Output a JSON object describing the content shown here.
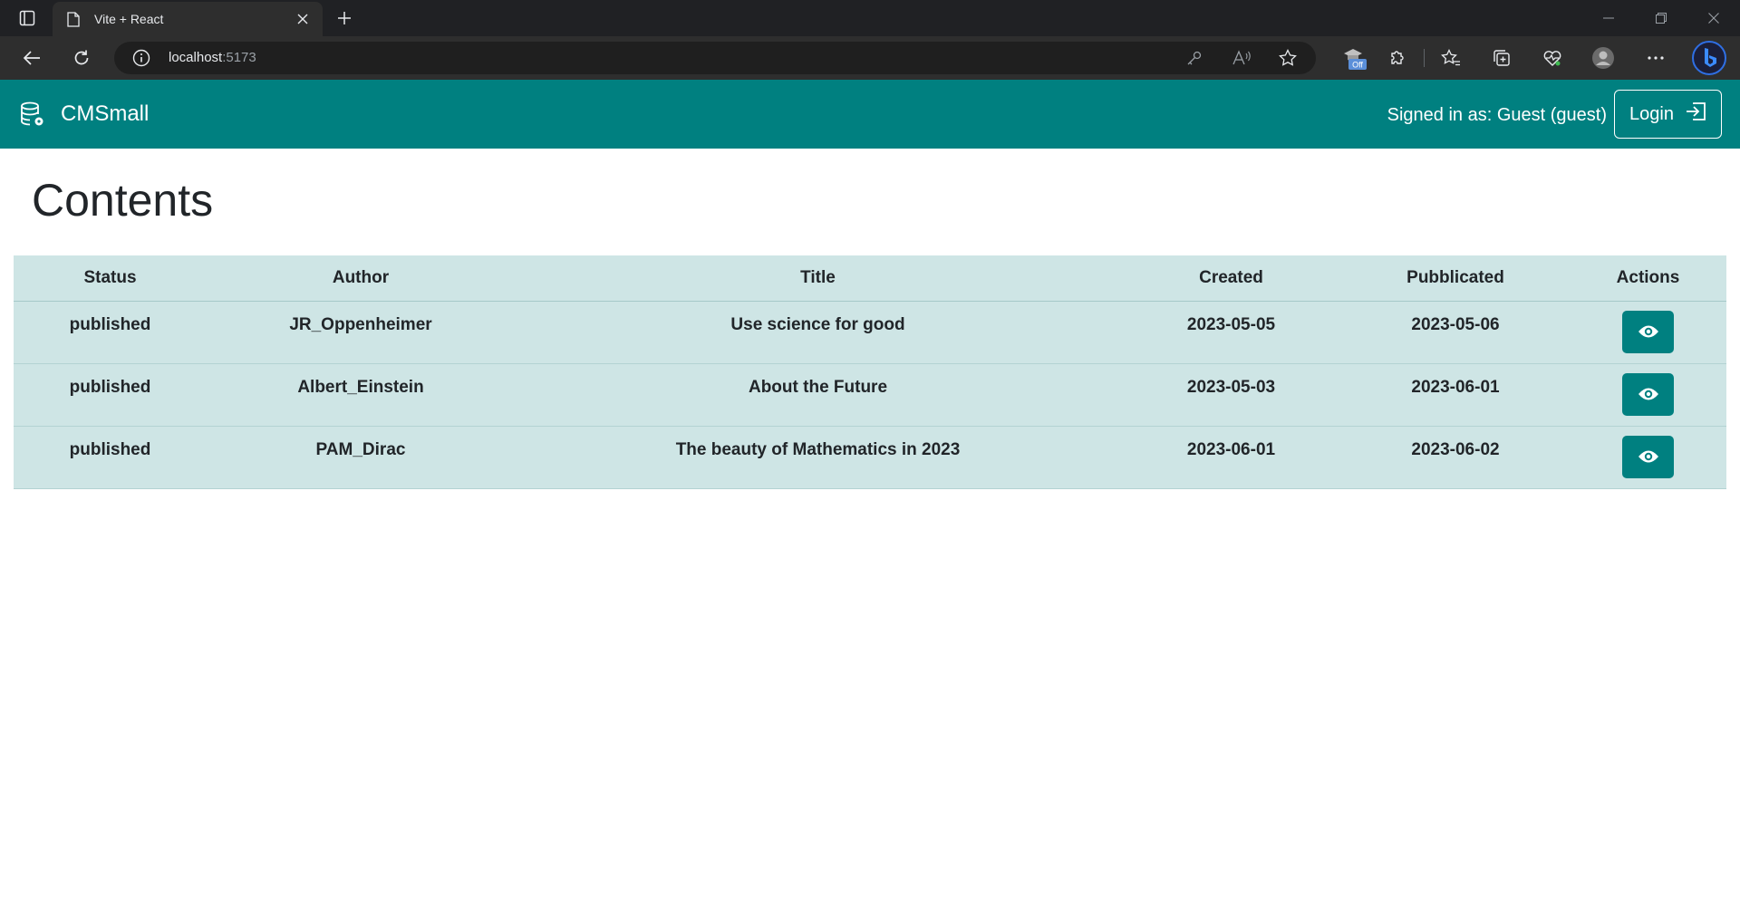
{
  "browser": {
    "tab_title": "Vite + React",
    "url_host": "localhost",
    "url_port": ":5173",
    "extension_badge": "Off"
  },
  "navbar": {
    "brand": "CMSmall",
    "signed_in_text": "Signed in as: Guest (guest)",
    "login_label": "Login",
    "bg_color": "#008080"
  },
  "page": {
    "title": "Contents"
  },
  "table": {
    "headers": [
      "Status",
      "Author",
      "Title",
      "Created",
      "Pubblicated",
      "Actions"
    ],
    "rows": [
      {
        "status": "published",
        "author": "JR_Oppenheimer",
        "title": "Use science for good",
        "created": "2023-05-05",
        "published": "2023-05-06",
        "action_icon": "eye-icon"
      },
      {
        "status": "published",
        "author": "Albert_Einstein",
        "title": "About the Future",
        "created": "2023-05-03",
        "published": "2023-06-01",
        "action_icon": "eye-icon"
      },
      {
        "status": "published",
        "author": "PAM_Dirac",
        "title": "The beauty of Mathematics in 2023",
        "created": "2023-06-01",
        "published": "2023-06-02",
        "action_icon": "eye-icon"
      }
    ]
  }
}
